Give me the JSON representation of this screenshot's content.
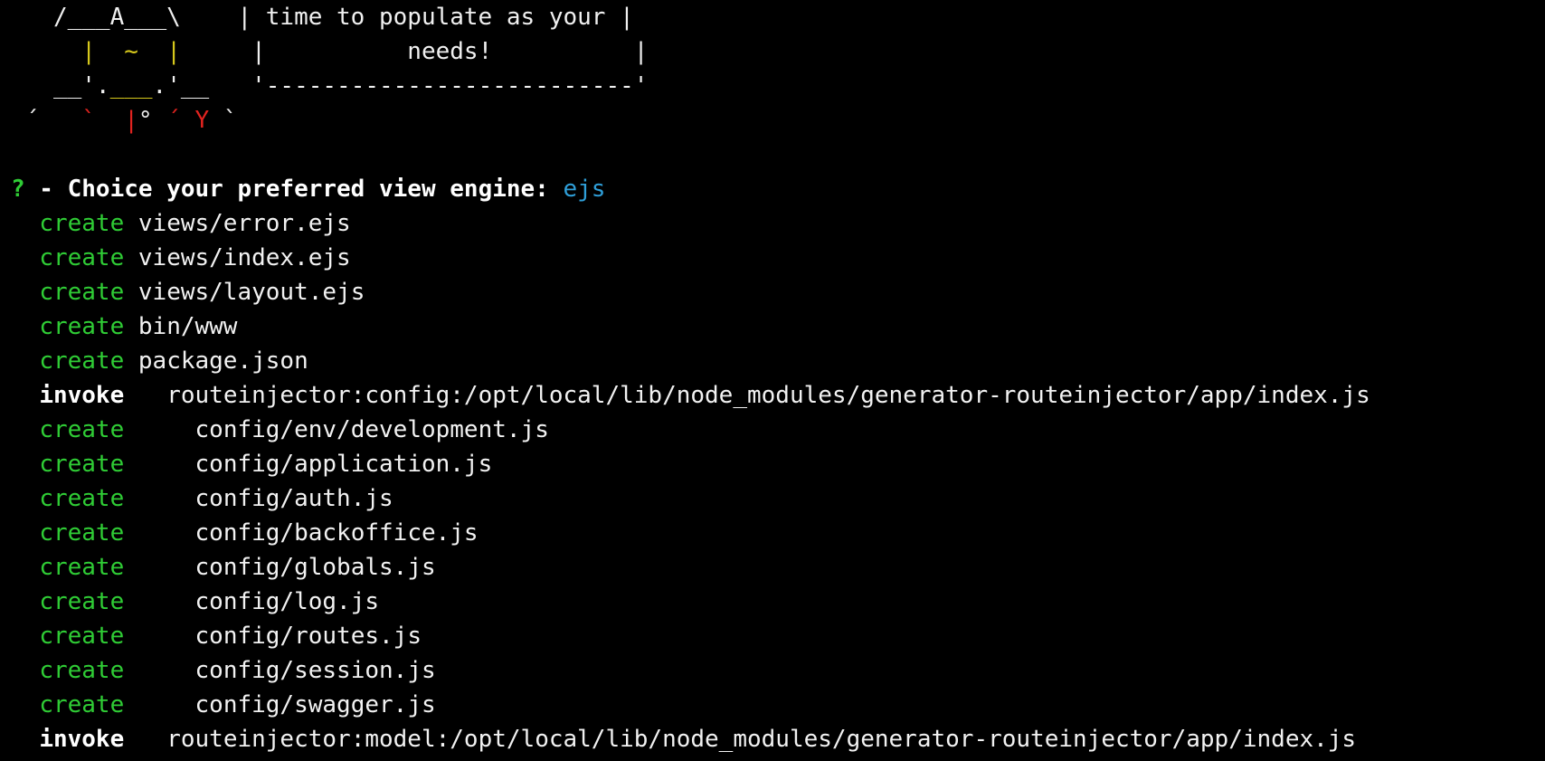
{
  "banner": {
    "ascii_line1": "   /___A___\\    ",
    "bubble_line1": "| time to populate as your |",
    "ascii_line2_a": "     |  ",
    "ascii_line2_tilde": "~",
    "ascii_line2_b": "  |     ",
    "bubble_line2": "|          needs!          |",
    "ascii_line3_a": "   __'.",
    "ascii_line3_mid": "___",
    "ascii_line3_b": ".'__   ",
    "bubble_line3": "'--------------------------'",
    "ascii_line4_a": " ´   ",
    "ascii_line4_tick": "`  ",
    "ascii_line4_red1": "|",
    "ascii_line4_deg": "° ",
    "ascii_line4_red2": "´ Y",
    "ascii_line4_end": " `"
  },
  "prompt": {
    "marker": "?",
    "question": " - Choice your preferred view engine: ",
    "answer": "ejs"
  },
  "output": [
    {
      "action": "create",
      "indent": "  ",
      "gap": " ",
      "path": "views/error.ejs"
    },
    {
      "action": "create",
      "indent": "  ",
      "gap": " ",
      "path": "views/index.ejs"
    },
    {
      "action": "create",
      "indent": "  ",
      "gap": " ",
      "path": "views/layout.ejs"
    },
    {
      "action": "create",
      "indent": "  ",
      "gap": " ",
      "path": "bin/www"
    },
    {
      "action": "create",
      "indent": "  ",
      "gap": " ",
      "path": "package.json"
    },
    {
      "action": "invoke",
      "indent": "  ",
      "gap": "   ",
      "path": "routeinjector:config:/opt/local/lib/node_modules/generator-routeinjector/app/index.js"
    },
    {
      "action": "create",
      "indent": "  ",
      "gap": "     ",
      "path": "config/env/development.js"
    },
    {
      "action": "create",
      "indent": "  ",
      "gap": "     ",
      "path": "config/application.js"
    },
    {
      "action": "create",
      "indent": "  ",
      "gap": "     ",
      "path": "config/auth.js"
    },
    {
      "action": "create",
      "indent": "  ",
      "gap": "     ",
      "path": "config/backoffice.js"
    },
    {
      "action": "create",
      "indent": "  ",
      "gap": "     ",
      "path": "config/globals.js"
    },
    {
      "action": "create",
      "indent": "  ",
      "gap": "     ",
      "path": "config/log.js"
    },
    {
      "action": "create",
      "indent": "  ",
      "gap": "     ",
      "path": "config/routes.js"
    },
    {
      "action": "create",
      "indent": "  ",
      "gap": "     ",
      "path": "config/session.js"
    },
    {
      "action": "create",
      "indent": "  ",
      "gap": "     ",
      "path": "config/swagger.js"
    },
    {
      "action": "invoke",
      "indent": "  ",
      "gap": "   ",
      "path": "routeinjector:model:/opt/local/lib/node_modules/generator-routeinjector/app/index.js"
    }
  ],
  "colors": {
    "background": "#000000",
    "text": "#f2f2f2",
    "create": "#2fcc35",
    "invoke": "#ffffff",
    "answer": "#2f9fd9",
    "yellow": "#d6c81c",
    "red": "#e0231f"
  }
}
